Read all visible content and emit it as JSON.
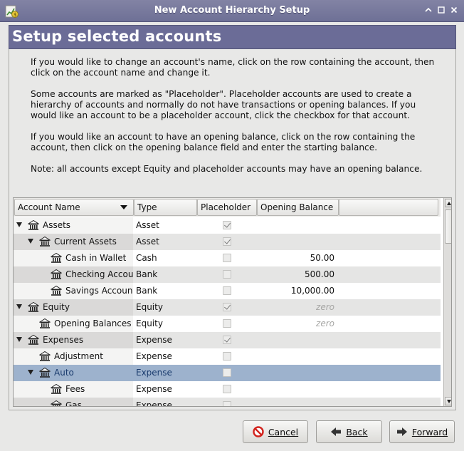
{
  "window": {
    "title": "New Account Hierarchy Setup",
    "icon": "gnucash-app-icon",
    "controls": [
      "restore-icon",
      "maximize-icon",
      "close-icon"
    ]
  },
  "page": {
    "title": "Setup selected accounts",
    "instructions": [
      "If you would like to change an account's name, click on the row containing the account, then click on the account name and change it.",
      "Some accounts are marked as \"Placeholder\". Placeholder accounts are used to create a hierarchy of accounts and normally do not have transactions or opening balances. If you would like an account to be a placeholder account, click the checkbox for that account.",
      "If you would like an account to have an opening balance, click on the row containing the account, then click on the opening balance field and enter the starting balance.",
      "Note: all accounts except Equity and placeholder accounts may have an opening balance."
    ]
  },
  "table": {
    "columns": [
      "Account Name",
      "Type",
      "Placeholder",
      "Opening Balance"
    ],
    "rows": [
      {
        "name": "Assets",
        "type": "Asset",
        "placeholder": true,
        "balance": "",
        "depth": 0,
        "expanded": true
      },
      {
        "name": "Current Assets",
        "type": "Asset",
        "placeholder": true,
        "balance": "",
        "depth": 1,
        "expanded": true
      },
      {
        "name": "Cash in Wallet",
        "type": "Cash",
        "placeholder": false,
        "balance": "50.00",
        "depth": 2,
        "expanded": false
      },
      {
        "name": "Checking Account",
        "type": "Bank",
        "placeholder": false,
        "balance": "500.00",
        "depth": 2,
        "expanded": false
      },
      {
        "name": "Savings Account",
        "type": "Bank",
        "placeholder": false,
        "balance": "10,000.00",
        "depth": 2,
        "expanded": false
      },
      {
        "name": "Equity",
        "type": "Equity",
        "placeholder": true,
        "balance": "zero",
        "depth": 0,
        "expanded": true
      },
      {
        "name": "Opening Balances",
        "type": "Equity",
        "placeholder": false,
        "balance": "zero",
        "depth": 1,
        "expanded": false
      },
      {
        "name": "Expenses",
        "type": "Expense",
        "placeholder": true,
        "balance": "",
        "depth": 0,
        "expanded": true
      },
      {
        "name": "Adjustment",
        "type": "Expense",
        "placeholder": false,
        "balance": "",
        "depth": 1,
        "expanded": false
      },
      {
        "name": "Auto",
        "type": "Expense",
        "placeholder": false,
        "balance": "",
        "depth": 1,
        "expanded": true,
        "selected": true
      },
      {
        "name": "Fees",
        "type": "Expense",
        "placeholder": false,
        "balance": "",
        "depth": 2,
        "expanded": false
      },
      {
        "name": "Gas",
        "type": "Expense",
        "placeholder": false,
        "balance": "",
        "depth": 2,
        "expanded": false
      }
    ]
  },
  "buttons": {
    "cancel": {
      "label": "Cancel",
      "icon": "cancel-icon"
    },
    "back": {
      "label": "Back",
      "icon": "back-arrow-icon"
    },
    "forward": {
      "label": "Forward",
      "icon": "forward-arrow-icon"
    }
  },
  "colors": {
    "title_bar": "#7677a0",
    "page_header": "#6b6c97",
    "selection": "#9db2cd"
  }
}
